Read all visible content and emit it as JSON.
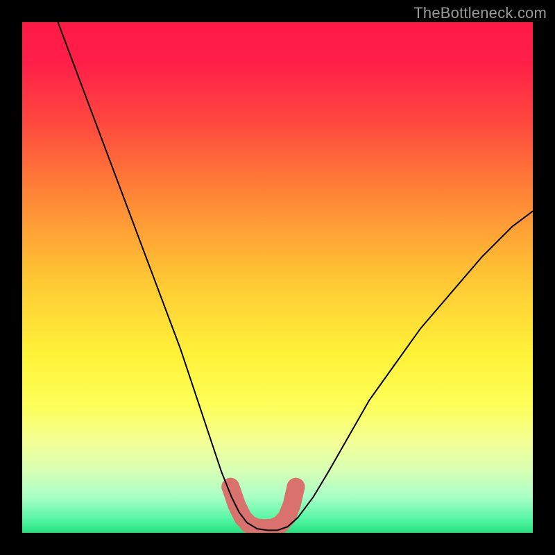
{
  "watermark": "TheBottleneck.com",
  "chart_data": {
    "type": "line",
    "title": "",
    "xlabel": "",
    "ylabel": "",
    "xlim": [
      0,
      100
    ],
    "ylim": [
      0,
      100
    ],
    "grid": false,
    "legend": false,
    "background": {
      "type": "vertical-gradient",
      "stops": [
        {
          "pos": 0.0,
          "color": "#ff1a46"
        },
        {
          "pos": 0.08,
          "color": "#ff1f48"
        },
        {
          "pos": 0.2,
          "color": "#ff4a3e"
        },
        {
          "pos": 0.35,
          "color": "#ff8a36"
        },
        {
          "pos": 0.5,
          "color": "#ffc634"
        },
        {
          "pos": 0.65,
          "color": "#fff238"
        },
        {
          "pos": 0.75,
          "color": "#fdff58"
        },
        {
          "pos": 0.82,
          "color": "#f4ff94"
        },
        {
          "pos": 0.88,
          "color": "#d6ffb6"
        },
        {
          "pos": 0.93,
          "color": "#a8ffc6"
        },
        {
          "pos": 0.97,
          "color": "#5cf7a7"
        },
        {
          "pos": 1.0,
          "color": "#25e27f"
        }
      ]
    },
    "series": [
      {
        "name": "curve",
        "color": "#000000",
        "width": 2,
        "x": [
          7,
          10,
          13,
          16,
          19,
          22,
          25,
          28,
          31,
          33,
          35,
          37,
          39,
          41,
          42.5,
          44,
          46,
          48,
          50,
          52,
          54,
          57,
          60,
          64,
          68,
          73,
          78,
          84,
          90,
          96,
          100
        ],
        "y": [
          100,
          92,
          84,
          76,
          68,
          60,
          52,
          44,
          36,
          30,
          24,
          18,
          12,
          7,
          4,
          2,
          0.8,
          0.5,
          0.5,
          1.2,
          3,
          7,
          12,
          19,
          26,
          33,
          40,
          47,
          54,
          60,
          63
        ]
      }
    ],
    "highlight": {
      "name": "rounded-band",
      "color": "#d9716c",
      "x": [
        40.8,
        42.0,
        43.2,
        44.5,
        46.0,
        47.5,
        49.0,
        50.5,
        51.8,
        52.8,
        53.6
      ],
      "y": [
        9.0,
        5.5,
        3.0,
        1.6,
        1.0,
        0.9,
        1.0,
        1.6,
        3.0,
        5.5,
        9.0
      ],
      "width": 26,
      "endcap_radius": 13
    }
  }
}
